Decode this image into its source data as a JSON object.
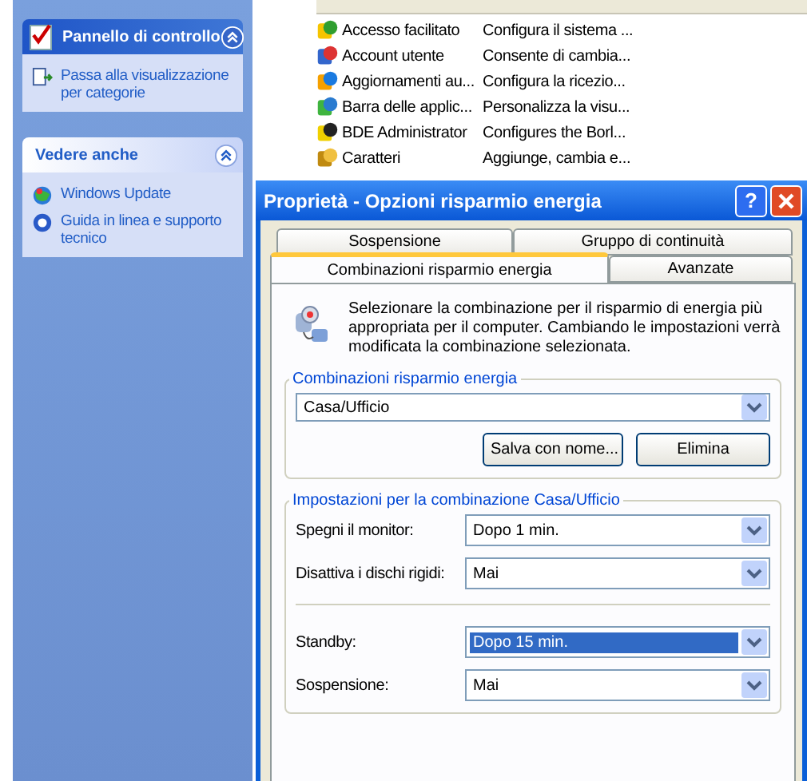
{
  "sidebar": {
    "panels": [
      {
        "title": "Pannello di controllo",
        "kind": "primary",
        "links": [
          "Passa alla visualizzazione per categorie"
        ]
      },
      {
        "title": "Vedere anche",
        "kind": "secondary",
        "links": [
          "Windows Update",
          "Guida in linea e supporto tecnico"
        ]
      }
    ]
  },
  "items": [
    {
      "name": "Accesso facilitato",
      "comment": "Configura il sistema ..."
    },
    {
      "name": "Account utente",
      "comment": "Consente di cambia..."
    },
    {
      "name": "Aggiornamenti au...",
      "comment": "Configura la ricezio..."
    },
    {
      "name": "Barra delle applic...",
      "comment": "Personalizza la visu..."
    },
    {
      "name": "BDE Administrator",
      "comment": "Configures the Borl..."
    },
    {
      "name": "Caratteri",
      "comment": "Aggiunge, cambia e..."
    }
  ],
  "dialog": {
    "title": "Proprietà - Opzioni risparmio energia",
    "help_button": "?",
    "tab_rows": [
      [
        {
          "label": "Sospensione",
          "selected": false
        },
        {
          "label": "Gruppo di continuità",
          "selected": false
        }
      ],
      [
        {
          "label": "Combinazioni risparmio energia",
          "selected": true
        },
        {
          "label": "Avanzate",
          "selected": false
        }
      ]
    ],
    "description": "Selezionare la combinazione per il risparmio di energia più appropriata per il computer. Cambiando le impostazioni verrà modificata la combinazione selezionata.",
    "scheme_group": {
      "legend": "Combinazioni risparmio energia",
      "value": "Casa/Ufficio",
      "buttons": [
        "Salva con nome...",
        "Elimina"
      ]
    },
    "settings_group": {
      "legend": "Impostazioni per la combinazione Casa/Ufficio",
      "sections": [
        [
          {
            "label": "Spegni il monitor:",
            "value": "Dopo 1 min.",
            "highlighted": false
          },
          {
            "label": "Disattiva i dischi rigidi:",
            "value": "Mai",
            "highlighted": false
          }
        ],
        [
          {
            "label": "Standby:",
            "value": "Dopo 15 min.",
            "highlighted": true
          },
          {
            "label": "Sospensione:",
            "value": "Mai",
            "highlighted": false
          }
        ]
      ]
    }
  }
}
